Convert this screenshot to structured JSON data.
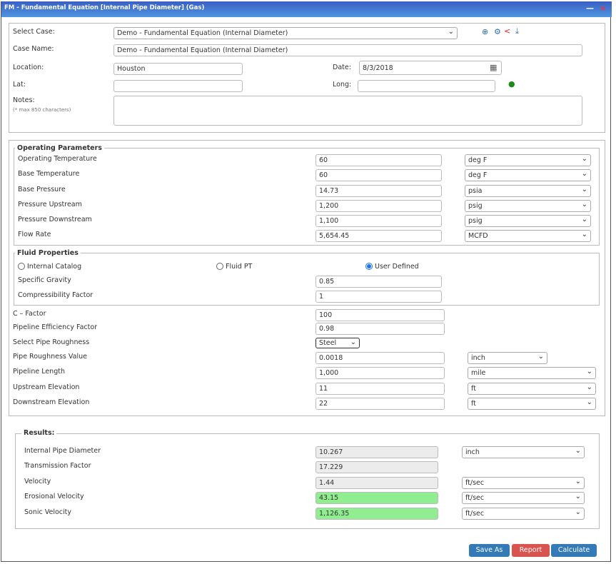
{
  "window": {
    "title": "FM - Fundamental Equation [Internal Pipe Diameter] (Gas)",
    "minimize": "—",
    "close": "×"
  },
  "case": {
    "select_case_label": "Select Case:",
    "select_case_value": "Demo - Fundamental Equation (Internal Diameter)",
    "case_name_label": "Case Name:",
    "case_name_value": "Demo - Fundamental Equation (Internal Diameter)",
    "location_label": "Location:",
    "location_value": "Houston",
    "date_label": "Date:",
    "date_value": "8/3/2018",
    "lat_label": "Lat:",
    "lat_value": "",
    "long_label": "Long:",
    "long_value": "",
    "notes_label": "Notes:",
    "notes_hint": "(* max 850 characters)",
    "notes_value": ""
  },
  "operating": {
    "legend": "Operating Parameters",
    "rows": [
      {
        "label": "Operating Temperature",
        "value": "60",
        "unit": "deg F"
      },
      {
        "label": "Base Temperature",
        "value": "60",
        "unit": "deg F"
      },
      {
        "label": "Base Pressure",
        "value": "14.73",
        "unit": "psia"
      },
      {
        "label": "Pressure Upstream",
        "value": "1,200",
        "unit": "psig"
      },
      {
        "label": "Pressure Downstream",
        "value": "1,100",
        "unit": "psig"
      },
      {
        "label": "Flow Rate",
        "value": "5,654.45",
        "unit": "MCFD"
      }
    ]
  },
  "fluid": {
    "legend": "Fluid Properties",
    "options": [
      "Internal Catalog",
      "Fluid PT",
      "User Defined"
    ],
    "selected": "User Defined",
    "rows": [
      {
        "label": "Specific Gravity",
        "value": "0.85"
      },
      {
        "label": "Compressibility Factor",
        "value": "1"
      }
    ]
  },
  "pipe": {
    "c_factor_label": "C – Factor",
    "c_factor_value": "100",
    "efficiency_label": "Pipeline Efficiency Factor",
    "efficiency_value": "0.98",
    "roughness_select_label": "Select Pipe Roughness",
    "roughness_select_value": "Steel",
    "roughness_value_label": "Pipe Roughness Value",
    "roughness_value": "0.0018",
    "roughness_unit": "inch",
    "length_label": "Pipeline Length",
    "length_value": "1,000",
    "length_unit": "mile",
    "up_elev_label": "Upstream Elevation",
    "up_elev_value": "11",
    "up_elev_unit": "ft",
    "down_elev_label": "Downstream Elevation",
    "down_elev_value": "22",
    "down_elev_unit": "ft"
  },
  "results": {
    "legend": "Results:",
    "rows": [
      {
        "label": "Internal Pipe Diameter",
        "value": "10.267",
        "unit": "inch"
      },
      {
        "label": "Transmission Factor",
        "value": "17.229"
      },
      {
        "label": "Velocity",
        "value": "1.44",
        "unit": "ft/sec"
      },
      {
        "label": "Erosional Velocity",
        "value": "43.15",
        "unit": "ft/sec",
        "highlight": true
      },
      {
        "label": "Sonic Velocity",
        "value": "1,126.35",
        "unit": "ft/sec",
        "highlight": true
      }
    ]
  },
  "buttons": {
    "save_as": "Save As",
    "report": "Report",
    "calculate": "Calculate"
  },
  "colors": {
    "title_bar": "#3a5fc4",
    "save": "#337ab7",
    "report": "#d9534f",
    "calculate": "#337ab7",
    "highlight": "#90ee90"
  }
}
